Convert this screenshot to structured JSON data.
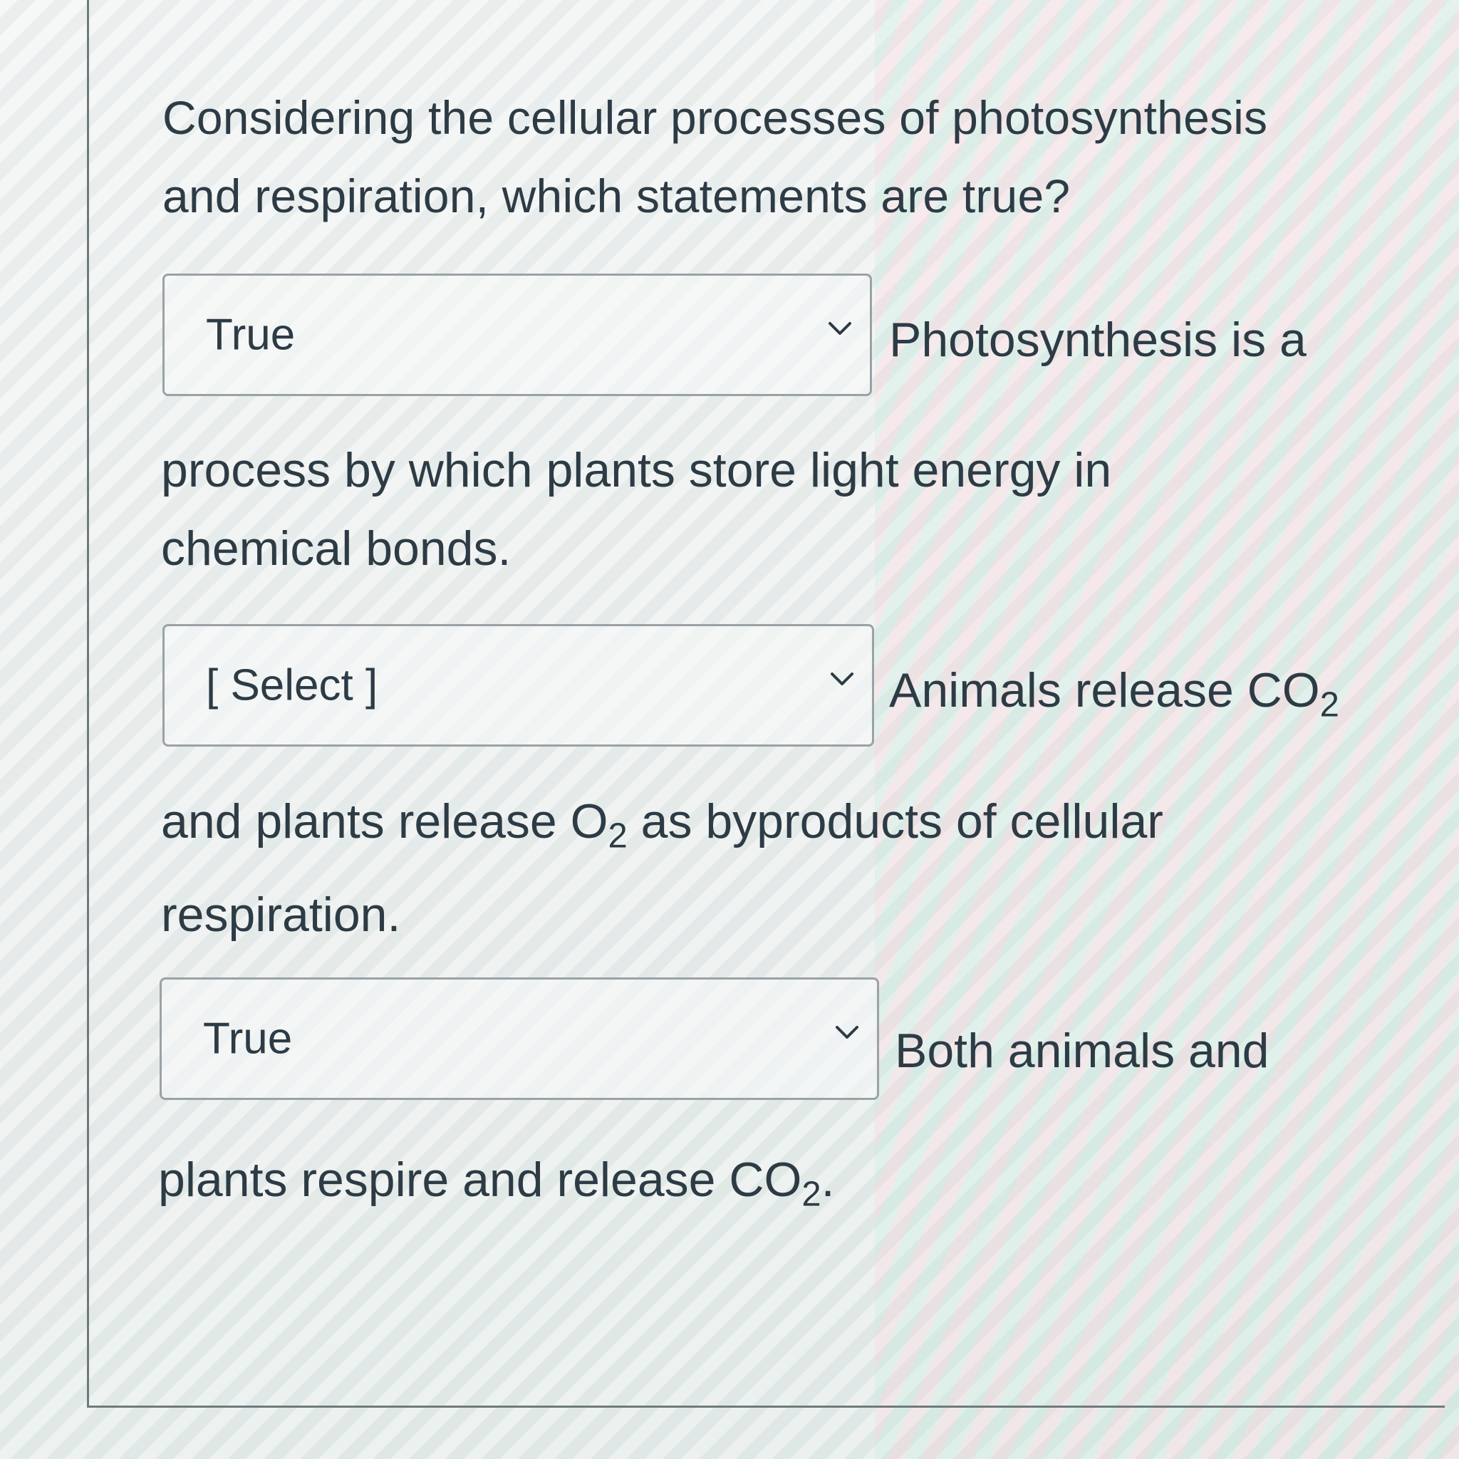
{
  "question": {
    "line1": "Considering the cellular processes of photosynthesis",
    "line2": "and respiration, which statements are true?"
  },
  "items": [
    {
      "selected": "True",
      "stmt_inline": "Photosynthesis is a",
      "stmt_line1": "process by which plants store light energy in",
      "stmt_line2": "chemical bonds."
    },
    {
      "selected": "[ Select ]",
      "stmt_inline_pre": "Animals release CO",
      "stmt_inline_sub": "2",
      "stmt_line1_pre": "and plants release O",
      "stmt_line1_sub": "2",
      "stmt_line1_post": " as byproducts of cellular",
      "stmt_line2": "respiration."
    },
    {
      "selected": "True",
      "stmt_inline": "Both animals and",
      "stmt_line1_pre": "plants respire and release CO",
      "stmt_line1_sub": "2",
      "stmt_line1_post": "."
    }
  ],
  "icons": {
    "dropdown": "chevron-down-icon"
  }
}
